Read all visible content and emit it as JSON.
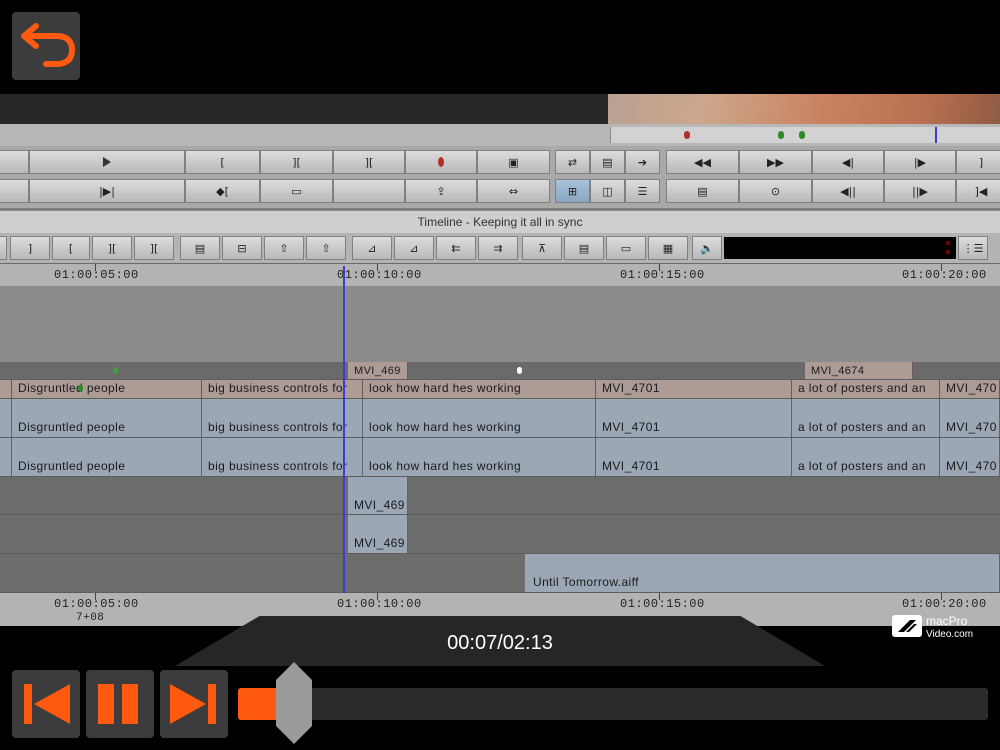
{
  "player": {
    "time_display": "00:07/02:13",
    "progress": 0.05,
    "logo_line1": "macPro",
    "logo_line2": "Video.com",
    "accent": "#ff5a0f"
  },
  "app": {
    "timeline_title": "Timeline - Keeping it all in sync",
    "top_ruler": [
      "01:00:05:00",
      "01:00:10:00",
      "01:00:15:00",
      "01:00:20:00"
    ],
    "bottom_ruler": [
      "01:00:05:00",
      "01:00:10:00",
      "01:00:15:00",
      "01:00:20:00"
    ],
    "bottom_sub_label": "7+08"
  },
  "tracks": {
    "clip_header": [
      "MVI_469",
      "MVI_4674"
    ],
    "v_row1": [
      "Disgruntled people",
      "big business controls for",
      "look how hard hes working",
      "MVI_4701",
      "a lot of posters and an",
      "MVI_470"
    ],
    "v_row2": [
      "Disgruntled people",
      "big business controls for",
      "look how hard hes working",
      "MVI_4701",
      "a lot of posters and an",
      "MVI_470"
    ],
    "v_row3": [
      "Disgruntled people",
      "big business controls for",
      "look how hard hes working",
      "MVI_4701",
      "a lot of posters and an",
      "MVI_470"
    ],
    "a_row1": "MVI_469",
    "a_row2": "MVI_469",
    "music_clip": "Until Tomorrow.aiff"
  },
  "icons": [
    "back-arrow-icon",
    "skip-back-icon",
    "pause-icon",
    "skip-forward-icon",
    "playhead-marker"
  ]
}
